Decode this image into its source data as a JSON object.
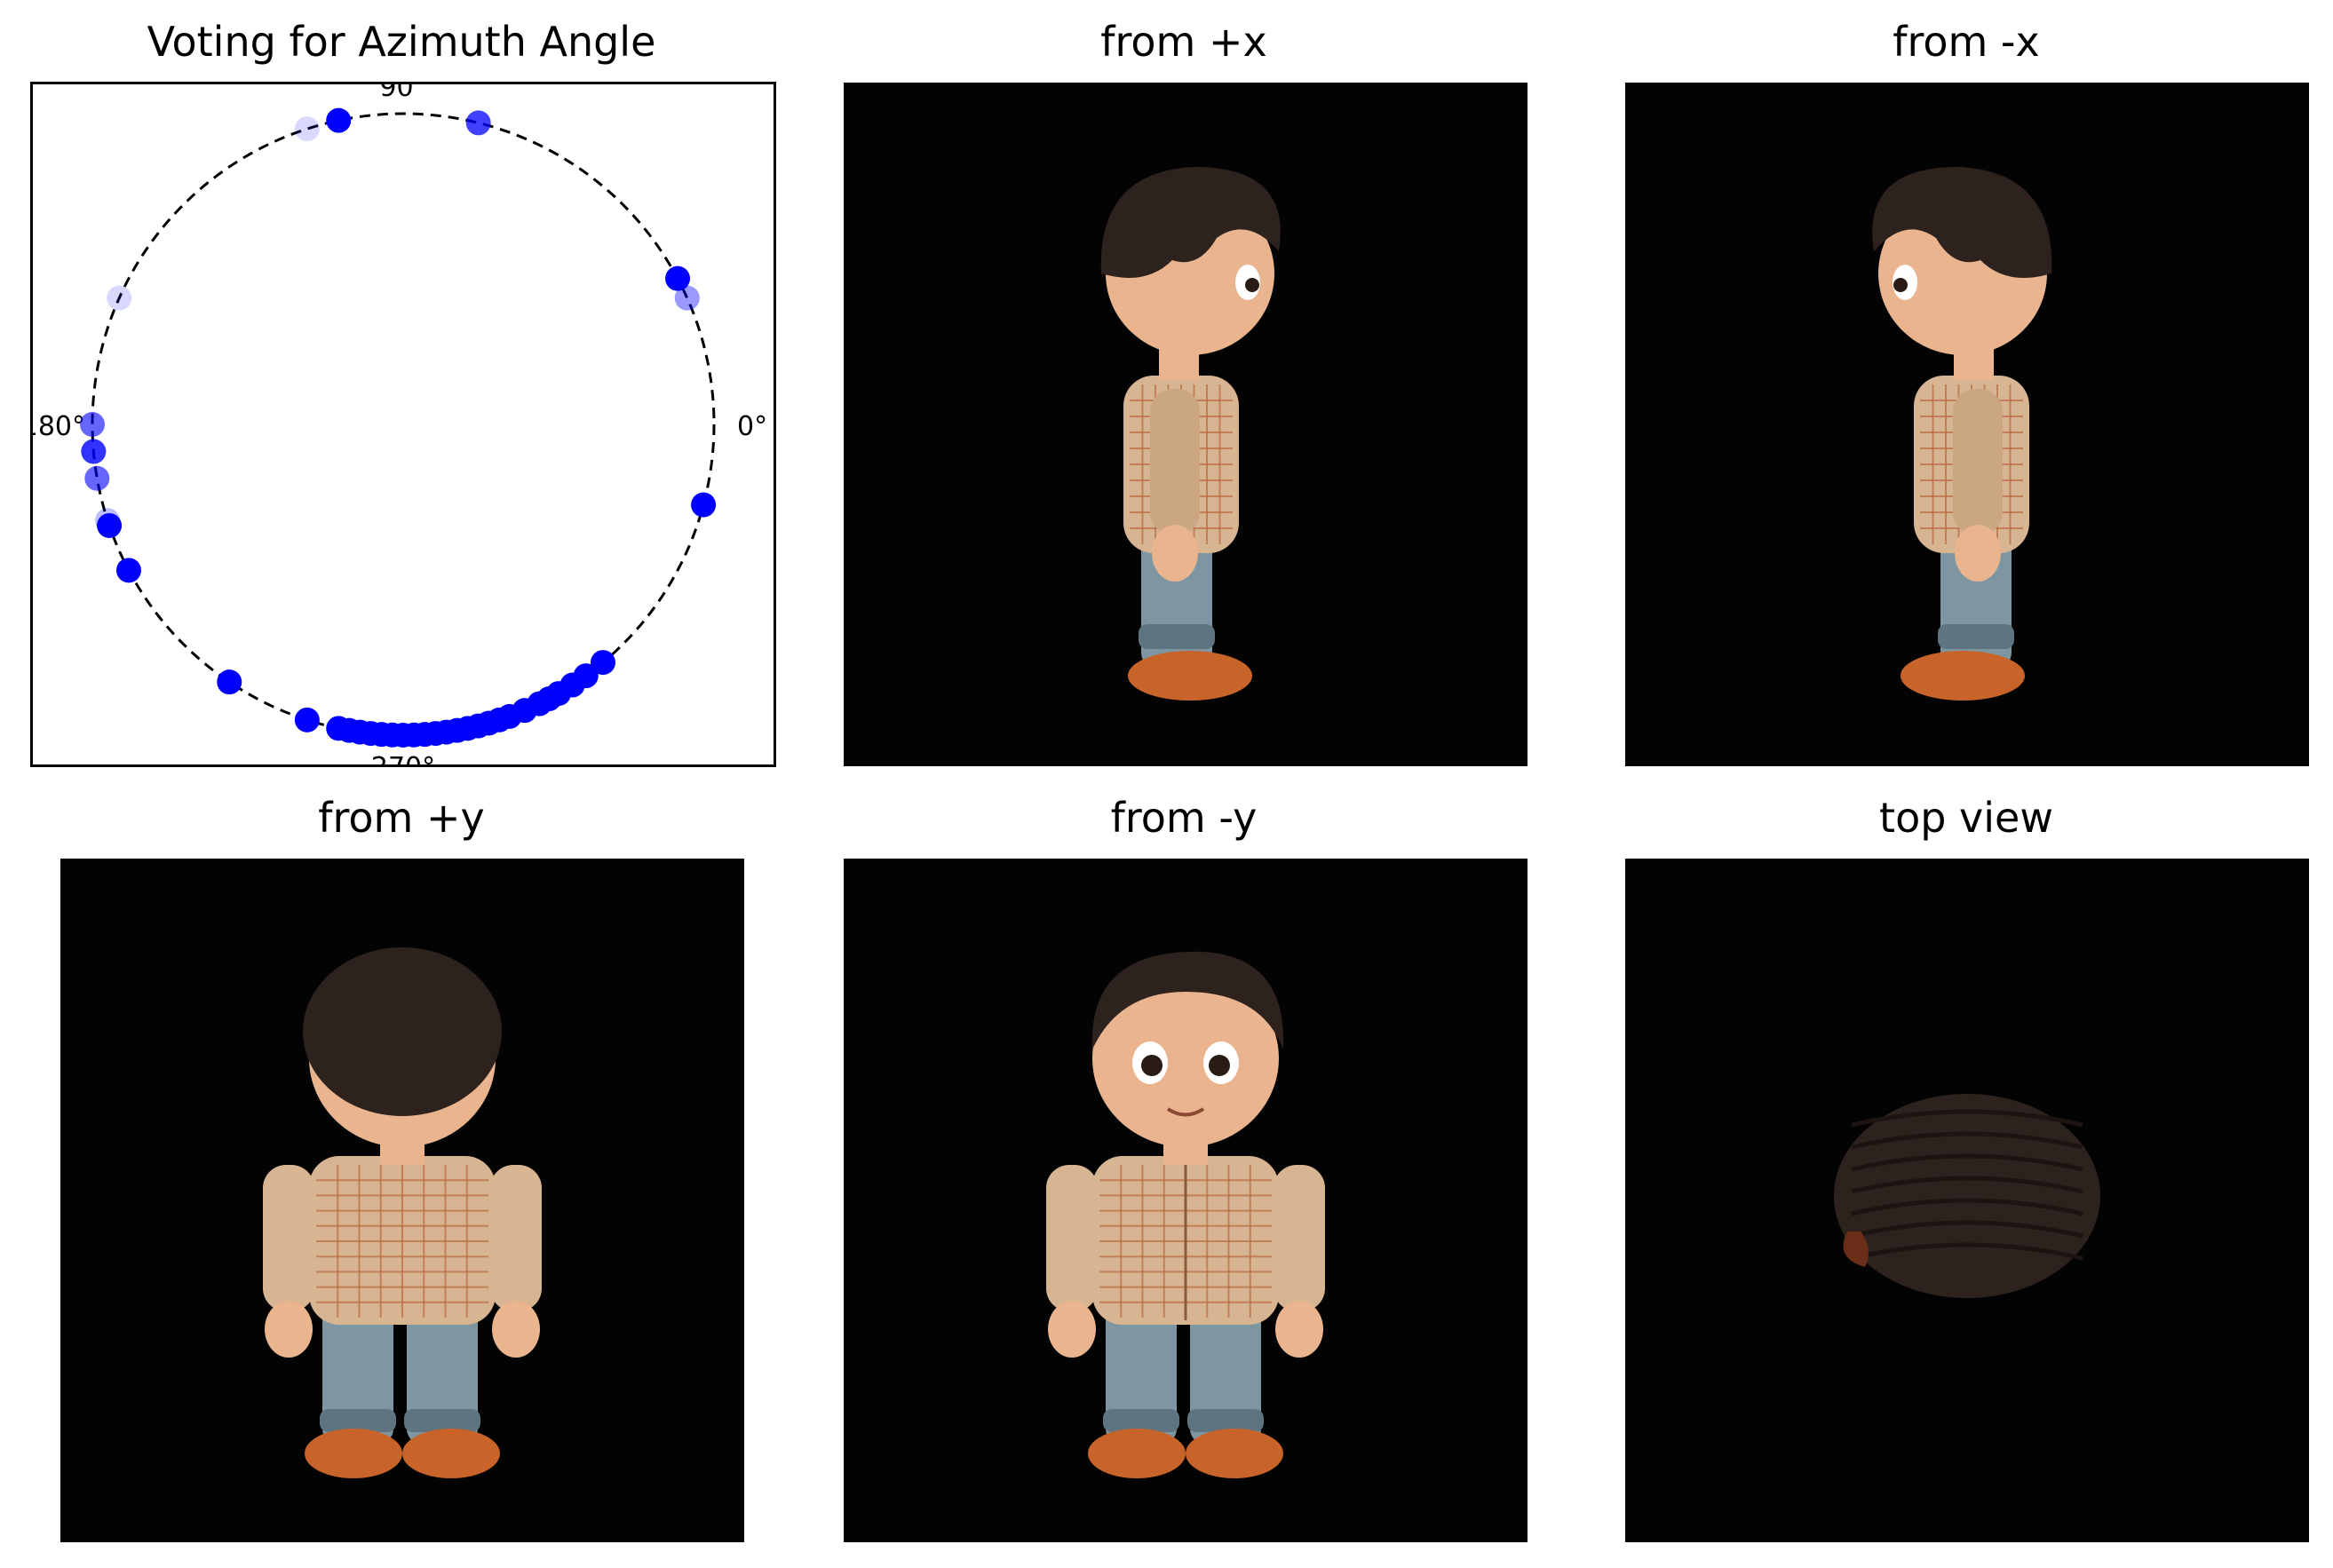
{
  "figure": {
    "panels": [
      {
        "title": "Voting for Azimuth Angle"
      },
      {
        "title": "from +x"
      },
      {
        "title": "from -x"
      },
      {
        "title": "from +y"
      },
      {
        "title": "from -y"
      },
      {
        "title": "top view"
      }
    ]
  },
  "colors": {
    "vote_point": "#0000ff",
    "circle": "#000000",
    "view_background": "#030303",
    "hair": "#2e221e",
    "skin": "#e9b48e",
    "shirt": "#d8b592",
    "shirt_check": "#b86a40",
    "jeans": "#7e96a2",
    "shoe": "#c8642a"
  },
  "chart_data": {
    "type": "scatter",
    "coordinate_system": "polar",
    "title": "Voting for Azimuth Angle",
    "angular_tick_labels": [
      "0°",
      "90°",
      "180°",
      "270°"
    ],
    "radius": 1,
    "grid": false,
    "circle_style": "dashed",
    "votes": [
      {
        "angle_deg": 102,
        "opacity": 1.0
      },
      {
        "angle_deg": 108,
        "opacity": 0.15
      },
      {
        "angle_deg": 76,
        "opacity": 0.75
      },
      {
        "angle_deg": 28,
        "opacity": 1.0
      },
      {
        "angle_deg": 24,
        "opacity": 0.4
      },
      {
        "angle_deg": 156,
        "opacity": 0.15
      },
      {
        "angle_deg": 180,
        "opacity": 0.6
      },
      {
        "angle_deg": 185,
        "opacity": 0.8
      },
      {
        "angle_deg": 190,
        "opacity": 0.6
      },
      {
        "angle_deg": 198,
        "opacity": 0.25
      },
      {
        "angle_deg": 199,
        "opacity": 1.0
      },
      {
        "angle_deg": 208,
        "opacity": 1.0
      },
      {
        "angle_deg": 236,
        "opacity": 1.0
      },
      {
        "angle_deg": 252,
        "opacity": 1.0
      },
      {
        "angle_deg": 258,
        "opacity": 1.0
      },
      {
        "angle_deg": 260,
        "opacity": 1.0
      },
      {
        "angle_deg": 262,
        "opacity": 1.0
      },
      {
        "angle_deg": 264,
        "opacity": 1.0
      },
      {
        "angle_deg": 266,
        "opacity": 1.0
      },
      {
        "angle_deg": 268,
        "opacity": 1.0
      },
      {
        "angle_deg": 270,
        "opacity": 1.0
      },
      {
        "angle_deg": 272,
        "opacity": 1.0
      },
      {
        "angle_deg": 274,
        "opacity": 1.0
      },
      {
        "angle_deg": 276,
        "opacity": 1.0
      },
      {
        "angle_deg": 278,
        "opacity": 1.0
      },
      {
        "angle_deg": 280,
        "opacity": 1.0
      },
      {
        "angle_deg": 282,
        "opacity": 1.0
      },
      {
        "angle_deg": 284,
        "opacity": 1.0
      },
      {
        "angle_deg": 286,
        "opacity": 1.0
      },
      {
        "angle_deg": 288,
        "opacity": 1.0
      },
      {
        "angle_deg": 290,
        "opacity": 1.0
      },
      {
        "angle_deg": 293,
        "opacity": 1.0
      },
      {
        "angle_deg": 296,
        "opacity": 1.0
      },
      {
        "angle_deg": 298,
        "opacity": 1.0
      },
      {
        "angle_deg": 300,
        "opacity": 1.0
      },
      {
        "angle_deg": 303,
        "opacity": 1.0
      },
      {
        "angle_deg": 306,
        "opacity": 1.0
      },
      {
        "angle_deg": 310,
        "opacity": 1.0
      },
      {
        "angle_deg": 345,
        "opacity": 1.0
      }
    ]
  }
}
